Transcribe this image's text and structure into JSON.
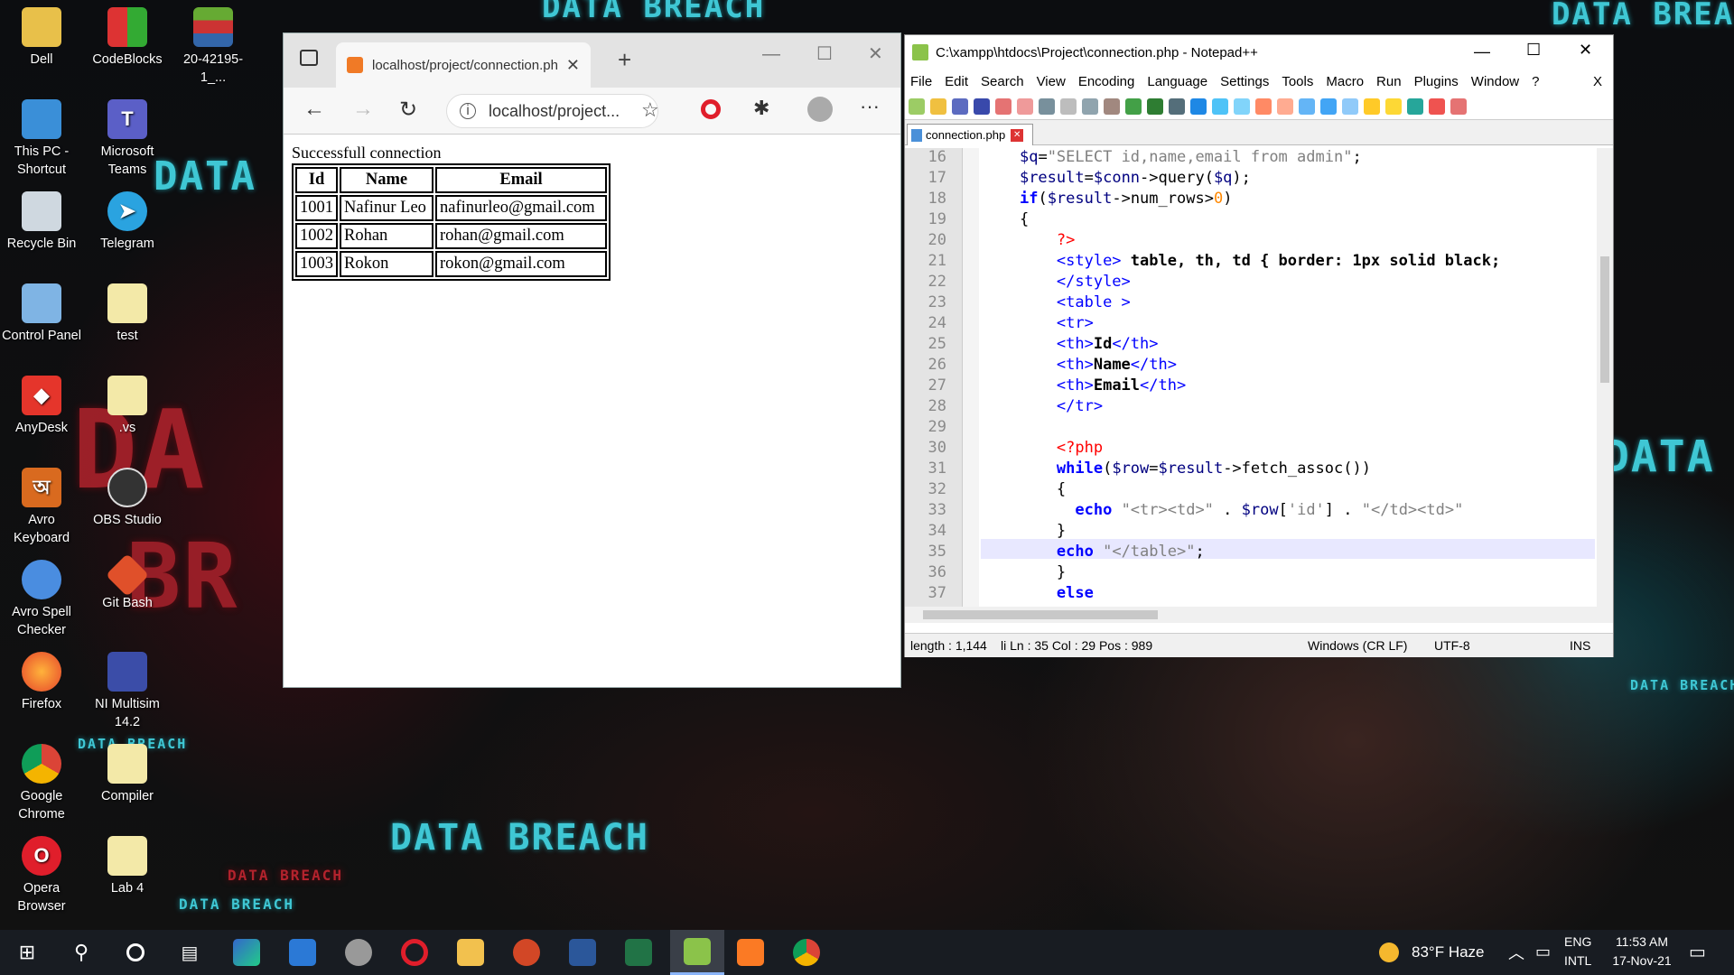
{
  "desktop": {
    "decor": {
      "top_center": "DATA BREACH",
      "top_right": "DATA BREA",
      "left_big": "DATA",
      "right_mid": "DATA",
      "bottom_center": "DATA BREACH",
      "bottom_left_1": "DATA BREACH",
      "bottom_left_2": "DATA BREACH",
      "bottom_left_3": "DATA BREACH",
      "bottom_right": "DATA BREACH"
    },
    "icons": [
      {
        "label": "Dell"
      },
      {
        "label": "CodeBlocks"
      },
      {
        "label": "20-42195-1_..."
      },
      {
        "label": "This PC - Shortcut"
      },
      {
        "label": "Microsoft Teams"
      },
      {
        "label": "Recycle Bin"
      },
      {
        "label": "Telegram"
      },
      {
        "label": "Control Panel"
      },
      {
        "label": "test"
      },
      {
        "label": "AnyDesk"
      },
      {
        "label": ".vs"
      },
      {
        "label": "Avro Keyboard"
      },
      {
        "label": "OBS Studio"
      },
      {
        "label": "Avro Spell Checker"
      },
      {
        "label": "Git Bash"
      },
      {
        "label": "Firefox"
      },
      {
        "label": "NI Multisim 14.2"
      },
      {
        "label": "Google Chrome"
      },
      {
        "label": "Compiler"
      },
      {
        "label": "Opera Browser"
      },
      {
        "label": "Lab 4"
      }
    ]
  },
  "browser": {
    "tab_title": "localhost/project/connection.ph",
    "address": "localhost/project...",
    "page_heading": "Successfull connection",
    "table": {
      "headers": [
        "Id",
        "Name",
        "Email"
      ],
      "rows": [
        [
          "1001",
          "Nafinur Leo",
          "nafinurleo@gmail.com"
        ],
        [
          "1002",
          "Rohan",
          "rohan@gmail.com"
        ],
        [
          "1003",
          "Rokon",
          "rokon@gmail.com"
        ]
      ]
    }
  },
  "notepadpp": {
    "title": "C:\\xampp\\htdocs\\Project\\connection.php - Notepad++",
    "menu": [
      "File",
      "Edit",
      "Search",
      "View",
      "Encoding",
      "Language",
      "Settings",
      "Tools",
      "Macro",
      "Run",
      "Plugins",
      "Window",
      "?"
    ],
    "menu_close": "X",
    "tab": "connection.php",
    "line_numbers": [
      "16",
      "17",
      "18",
      "19",
      "20",
      "21",
      "22",
      "23",
      "24",
      "25",
      "26",
      "27",
      "28",
      "29",
      "30",
      "31",
      "32",
      "33",
      "34",
      "35",
      "36",
      "37"
    ],
    "status": {
      "length": "length : 1,144",
      "pos": "li Ln : 35    Col : 29    Pos : 989",
      "eol": "Windows (CR LF)",
      "encoding": "UTF-8",
      "mode": "INS"
    }
  },
  "taskbar": {
    "weather": "83°F  Haze",
    "lang_1": "ENG",
    "lang_2": "INTL",
    "time": "11:53 AM",
    "date": "17-Nov-21"
  },
  "colors": {
    "taskbar": "#181c22",
    "accent_cyan": "#3fc7d4",
    "accent_red": "#b3232d"
  }
}
